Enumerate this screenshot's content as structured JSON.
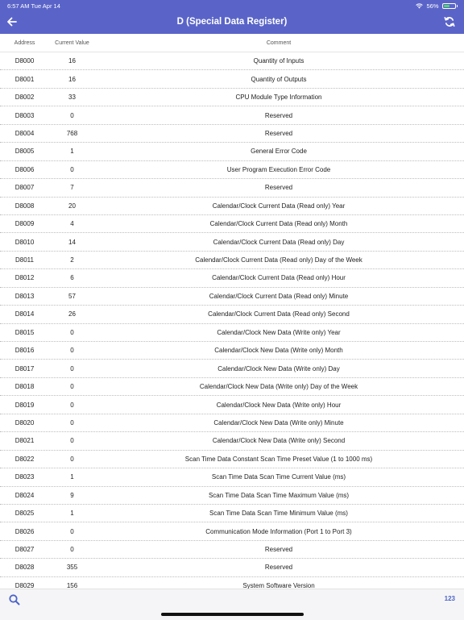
{
  "status_bar": {
    "time": "6:57 AM   Tue Apr 14",
    "battery": "56%",
    "battery_level": 0.56
  },
  "header": {
    "title": "D (Special Data Register)"
  },
  "columns": {
    "address": "Address",
    "value": "Current Value",
    "comment": "Comment"
  },
  "rows": [
    {
      "address": "D8000",
      "value": "16",
      "comment": "Quantity of Inputs"
    },
    {
      "address": "D8001",
      "value": "16",
      "comment": "Quantity of Outputs"
    },
    {
      "address": "D8002",
      "value": "33",
      "comment": "CPU Module Type Information"
    },
    {
      "address": "D8003",
      "value": "0",
      "comment": "Reserved"
    },
    {
      "address": "D8004",
      "value": "768",
      "comment": "Reserved"
    },
    {
      "address": "D8005",
      "value": "1",
      "comment": "General Error Code"
    },
    {
      "address": "D8006",
      "value": "0",
      "comment": "User Program Execution Error Code"
    },
    {
      "address": "D8007",
      "value": "7",
      "comment": "Reserved"
    },
    {
      "address": "D8008",
      "value": "20",
      "comment": "Calendar/Clock Current Data (Read only) Year"
    },
    {
      "address": "D8009",
      "value": "4",
      "comment": "Calendar/Clock Current Data (Read only) Month"
    },
    {
      "address": "D8010",
      "value": "14",
      "comment": "Calendar/Clock Current Data (Read only) Day"
    },
    {
      "address": "D8011",
      "value": "2",
      "comment": "Calendar/Clock Current Data (Read only) Day of the Week"
    },
    {
      "address": "D8012",
      "value": "6",
      "comment": "Calendar/Clock Current Data (Read only) Hour"
    },
    {
      "address": "D8013",
      "value": "57",
      "comment": "Calendar/Clock Current Data (Read only) Minute"
    },
    {
      "address": "D8014",
      "value": "26",
      "comment": "Calendar/Clock Current Data (Read only) Second"
    },
    {
      "address": "D8015",
      "value": "0",
      "comment": "Calendar/Clock New Data (Write only) Year"
    },
    {
      "address": "D8016",
      "value": "0",
      "comment": "Calendar/Clock New Data (Write only) Month"
    },
    {
      "address": "D8017",
      "value": "0",
      "comment": "Calendar/Clock New Data (Write only) Day"
    },
    {
      "address": "D8018",
      "value": "0",
      "comment": "Calendar/Clock New Data (Write only) Day of the Week"
    },
    {
      "address": "D8019",
      "value": "0",
      "comment": "Calendar/Clock New Data (Write only) Hour"
    },
    {
      "address": "D8020",
      "value": "0",
      "comment": "Calendar/Clock New Data (Write only) Minute"
    },
    {
      "address": "D8021",
      "value": "0",
      "comment": "Calendar/Clock New Data (Write only) Second"
    },
    {
      "address": "D8022",
      "value": "0",
      "comment": "Scan Time Data Constant Scan Time Preset Value (1 to 1000 ms)"
    },
    {
      "address": "D8023",
      "value": "1",
      "comment": "Scan Time Data Scan Time Current Value (ms)"
    },
    {
      "address": "D8024",
      "value": "9",
      "comment": "Scan Time Data Scan Time Maximum Value (ms)"
    },
    {
      "address": "D8025",
      "value": "1",
      "comment": "Scan Time Data Scan Time Minimum Value (ms)"
    },
    {
      "address": "D8026",
      "value": "0",
      "comment": "Communication Mode Information (Port 1 to Port 3)"
    },
    {
      "address": "D8027",
      "value": "0",
      "comment": "Reserved"
    },
    {
      "address": "D8028",
      "value": "355",
      "comment": "Reserved"
    },
    {
      "address": "D8029",
      "value": "156",
      "comment": "System Software Version"
    }
  ],
  "bottom_bar": {
    "numeric_label": "123"
  },
  "icons": {
    "back": "arrow-left-icon",
    "refresh": "refresh-icon",
    "search": "search-icon",
    "wifi": "wifi-icon",
    "battery": "battery-icon"
  },
  "colors": {
    "accent": "#5a64c8",
    "link": "#4a63c8"
  }
}
